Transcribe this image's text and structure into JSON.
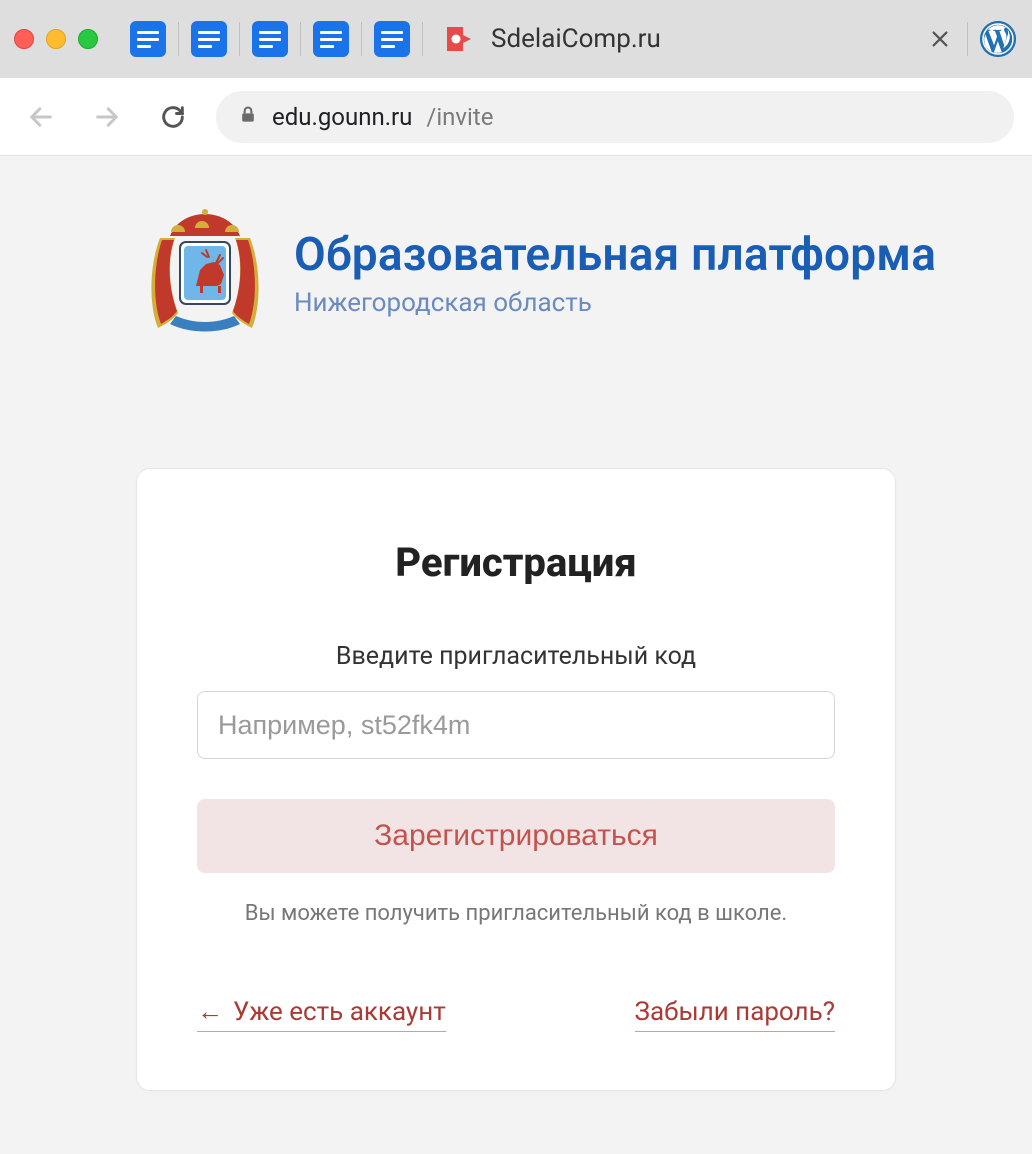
{
  "browser": {
    "active_tab_title": "SdelaiComp.ru",
    "url_host": "edu.gounn.ru",
    "url_path": "/invite"
  },
  "site": {
    "title": "Образовательная платформа",
    "subtitle": "Нижегородская область"
  },
  "card": {
    "heading": "Регистрация",
    "field_label": "Введите пригласительный код",
    "input_placeholder": "Например, st52fk4m",
    "register_button": "Зарегистрироваться",
    "help_text": "Вы можете получить пригласительный код в школе.",
    "existing_account_link": "Уже есть аккаунт",
    "forgot_password_link": "Забыли пароль?"
  }
}
